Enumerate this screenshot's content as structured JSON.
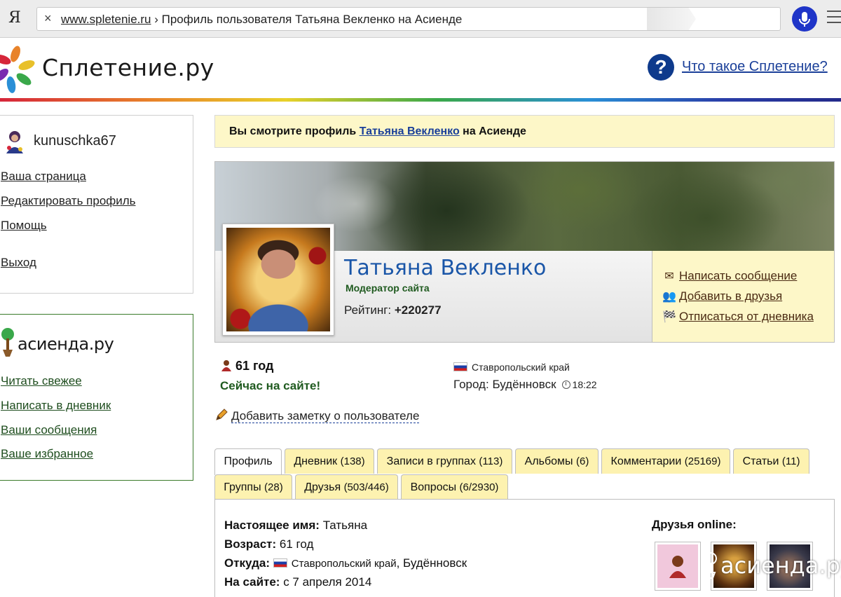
{
  "browser": {
    "logo": "Я",
    "close_glyph": "×",
    "url_domain": "www.spletenie.ru",
    "url_sep": " › ",
    "page_title": "Профиль пользователя Татьяна Векленко на Асиенде"
  },
  "site": {
    "title": "Сплетение.ру",
    "help_glyph": "?",
    "help_link": "Что такое Сплетение?"
  },
  "user_panel": {
    "username": "kunuschka67",
    "links": [
      "Ваша страница",
      "Редактировать профиль",
      "Помощь"
    ],
    "logout": "Выход"
  },
  "asienda_panel": {
    "title": "асиенда.ру",
    "links": [
      "Читать свежее",
      "Написать в дневник",
      "Ваши сообщения",
      "Ваше избранное"
    ]
  },
  "banner": {
    "prefix": "Вы смотрите профиль ",
    "name": "Татьяна Векленко",
    "suffix": " на Асиенде"
  },
  "profile": {
    "name": "Татьяна Векленко",
    "role": "Модератор сайта",
    "rating_label": "Рейтинг: ",
    "rating_value": "+220277",
    "actions": [
      {
        "icon": "envelope-icon",
        "glyph": "✉",
        "label": "Написать сообщение"
      },
      {
        "icon": "add-friend-icon",
        "glyph": "👥",
        "label": "Добавить в друзья"
      },
      {
        "icon": "checkered-flag-icon",
        "glyph": "🏁",
        "label": "Отписаться от дневника"
      }
    ],
    "age": "61 год",
    "online": "Сейчас на сайте!",
    "region": "Ставропольский край",
    "city_label": "Город: ",
    "city": "Будённовск",
    "local_time": "18:22",
    "add_note": "Добавить заметку о пользователе"
  },
  "tabs": [
    {
      "label": "Профиль",
      "count": ""
    },
    {
      "label": "Дневник",
      "count": "(138)"
    },
    {
      "label": "Записи в группах",
      "count": "(113)"
    },
    {
      "label": "Альбомы",
      "count": "(6)"
    },
    {
      "label": "Комментарии",
      "count": "(25169)"
    },
    {
      "label": "Статьи",
      "count": "(11)"
    },
    {
      "label": "Группы",
      "count": "(28)"
    },
    {
      "label": "Друзья",
      "count": "(503/446)"
    },
    {
      "label": "Вопросы",
      "count": "(6/2930)"
    }
  ],
  "details": {
    "real_name_label": "Настоящее имя:",
    "real_name": "Татьяна",
    "age_label": "Возраст:",
    "age": "61 год",
    "from_label": "Откуда:",
    "from_region": "Ставропольский край",
    "from_city": ", Будённовск",
    "since_label": "На сайте:",
    "since": "с 7 апреля 2014",
    "friends_online_label": "Друзья online:"
  },
  "watermark": "асиенда.ру",
  "colors": {
    "link_blue": "#1a3f99",
    "name_blue": "#1a56a8",
    "moderator_green": "#1f5a1f",
    "tab_yellow": "#fdf2b0",
    "banner_yellow": "#fdf7c8",
    "mic_blue": "#1f35c8"
  }
}
